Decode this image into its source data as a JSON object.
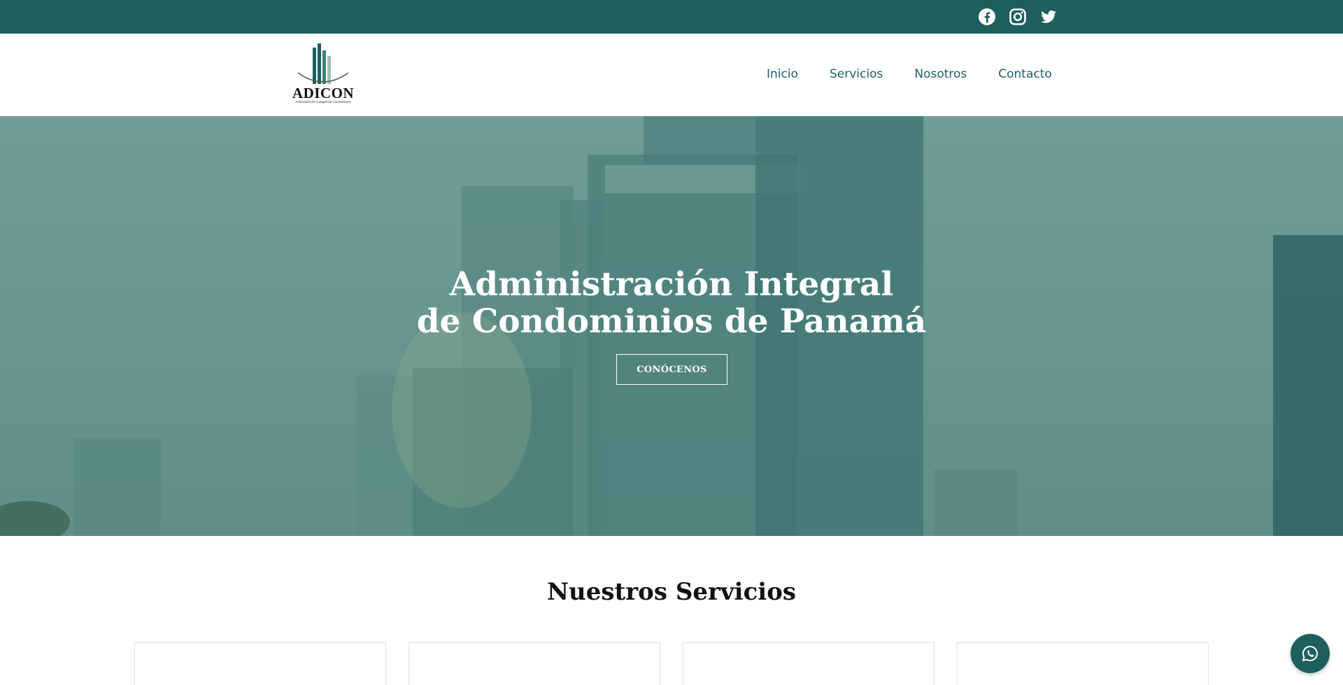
{
  "topbar": {
    "social_icons": [
      "facebook-icon",
      "instagram-icon",
      "twitter-icon"
    ]
  },
  "brand": {
    "name": "ADICON",
    "tagline": "Administración Integral de Condominios"
  },
  "nav": {
    "items": [
      {
        "label": "Inicio"
      },
      {
        "label": "Servicios"
      },
      {
        "label": "Nosotros"
      },
      {
        "label": "Contacto"
      }
    ]
  },
  "hero": {
    "title_line1": "Administración Integral",
    "title_line2": "de Condominios de Panamá",
    "button_label": "CONÓCENOS"
  },
  "services": {
    "title": "Nuestros Servicios",
    "card_count": 4
  },
  "floating": {
    "icon": "whatsapp-icon"
  },
  "colors": {
    "brand": "#1d5f5f",
    "hero_overlay": "#6a9893",
    "text_dark": "#111111"
  }
}
